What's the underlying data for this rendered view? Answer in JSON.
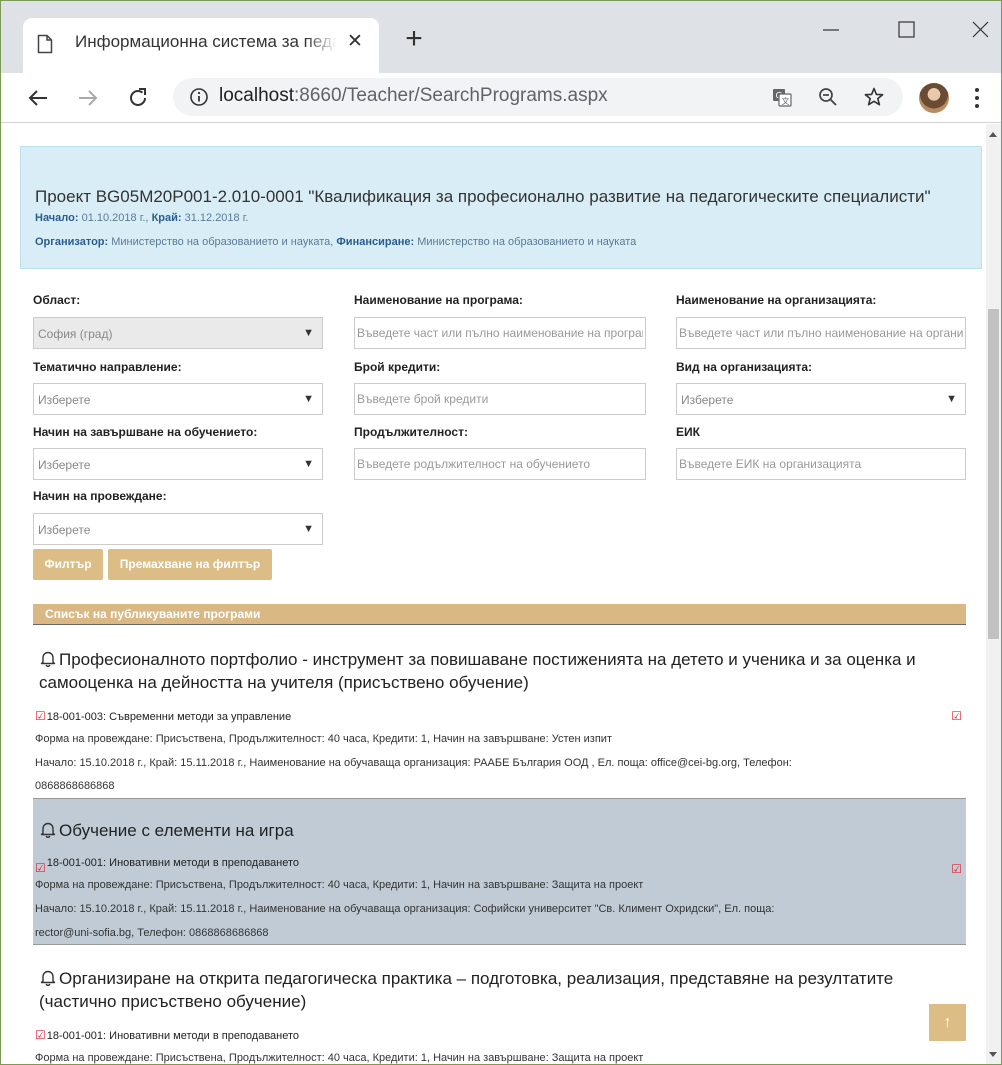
{
  "browser": {
    "tab_title": "Информационна система за педагогическите специалисти",
    "url_host": "localhost",
    "url_path": ":8660/Teacher/SearchPrograms.aspx"
  },
  "project": {
    "title": "Проект BG05M20P001-2.010-0001 \"Квалификация за професионално развитие на педагогическите специалисти\"",
    "start_label": "Начало:",
    "start_value": "01.10.2018 г.,",
    "end_label": "Край:",
    "end_value": "31.12.2018 г.",
    "organizer_label": "Организатор:",
    "organizer_value": "Министерство на образованието и науката,",
    "financing_label": "Финансиране:",
    "financing_value": "Министерство на образованието и науката"
  },
  "filters": {
    "region": {
      "label": "Област:",
      "value": "София (град)"
    },
    "program_name": {
      "label": "Наименование на програма:",
      "placeholder": "Въведете част или пълно наименование на програмата"
    },
    "org_name": {
      "label": "Наименование на организацията:",
      "placeholder": "Въведете част или пълно наименование на организацията"
    },
    "thematic": {
      "label": "Тематично направление:",
      "value": "Изберете"
    },
    "credits": {
      "label": "Брой кредити:",
      "placeholder": "Въведете брой кредити"
    },
    "org_type": {
      "label": "Вид на организацията:",
      "value": "Изберете"
    },
    "completion": {
      "label": "Начин на завършване на обучението:",
      "value": "Изберете"
    },
    "duration": {
      "label": "Продължителност:",
      "placeholder": "Въведете родължителност на обучението"
    },
    "eik": {
      "label": "ЕИК",
      "placeholder": "Въведете ЕИК на организацията"
    },
    "conduct": {
      "label": "Начин на провеждане:",
      "value": "Изберете"
    },
    "filter_button": "Филтър",
    "clear_button": "Премахване на филтър"
  },
  "list": {
    "header": "Списък на публикуваните програми",
    "items": [
      {
        "title": "Професионалното портфолио - инструмент за повишаване постиженията на детето и ученика и за оценка и самооценка на дейността на учителя (присъствено обучение)",
        "course_code": "18-001-003:",
        "course_name": "Съвременни методи за управление",
        "meta1": "Форма на провеждане: Присъствена, Продължителност: 40 часа, Кредити: 1, Начин на завършване: Устен изпит",
        "meta2": "Начало: 15.10.2018 г., Край: 15.11.2018 г., Наименование на обучаваща организация: РААБЕ България ООД , Ел. поща: office@cei-bg.org, Телефон:",
        "meta3": "0868868686868"
      },
      {
        "title": "Обучение с елементи на игра",
        "course_code": "18-001-001:",
        "course_name": "Иновативни методи в преподаването",
        "meta1": "Форма на провеждане: Присъствена, Продължителност: 40 часа, Кредити: 1, Начин на завършване: Защита на проект",
        "meta2": "Начало: 15.10.2018 г., Край: 15.11.2018 г., Наименование на обучаваща организация: Софийски университет \"Св. Климент Охридски\", Ел. поща:",
        "meta3": "rector@uni-sofia.bg, Телефон: 0868868686868"
      },
      {
        "title": "Организиране на открита педагогическа практика – подготовка, реализация, представяне на резултатите (частично присъствено обучение)",
        "course_code": "18-001-001:",
        "course_name": "Иновативни методи в преподаването",
        "meta1": "Форма на провеждане: Присъствена, Продължителност: 40 часа, Кредити: 1, Начин на завършване: Защита на проект"
      }
    ]
  },
  "icons": {
    "tab": "document-icon",
    "close": "close-icon",
    "new_tab": "plus-icon",
    "back": "arrow-left-icon",
    "forward": "arrow-right-icon",
    "reload": "reload-icon",
    "info": "info-icon",
    "translate": "translate-icon",
    "zoom": "zoom-out-icon",
    "star": "star-icon",
    "menu": "kebab-menu-icon",
    "bell": "bell-icon",
    "check": "checkbox-icon",
    "to_top": "arrow-up-icon"
  },
  "colors": {
    "accent": "#dbbd85",
    "project_box": "#d9edf6",
    "highlight_row": "#c0cbd6",
    "check_red": "#e2263a"
  }
}
